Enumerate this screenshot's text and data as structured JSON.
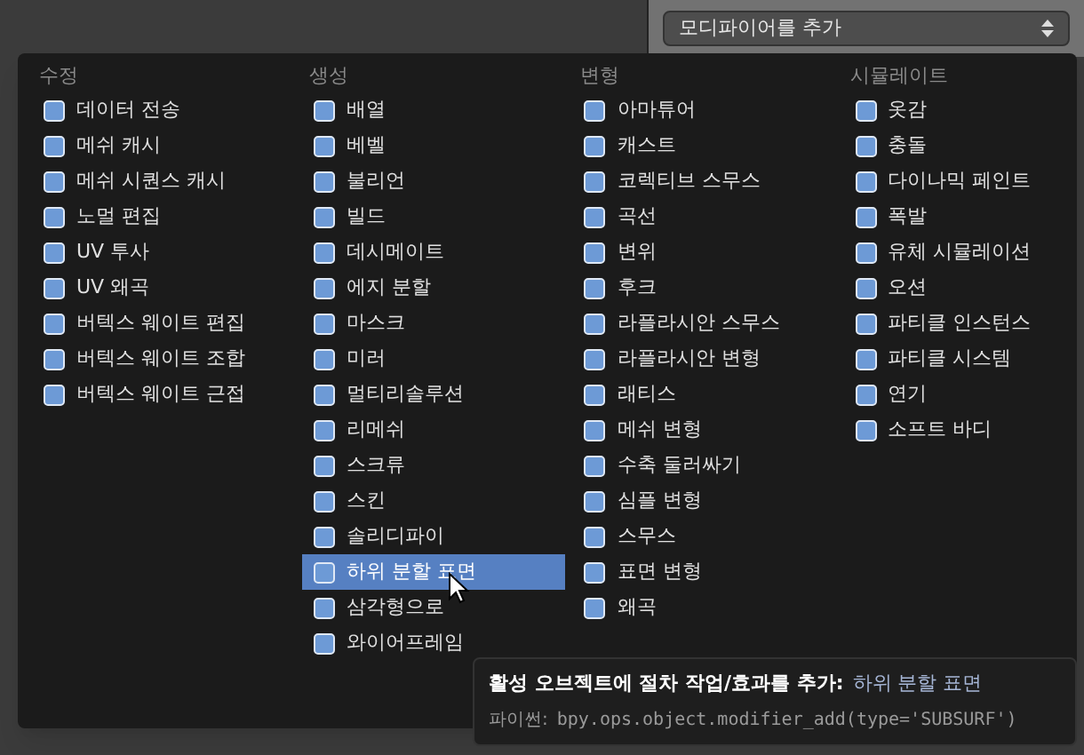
{
  "panel": {
    "dropdown": "모디파이어를 추가"
  },
  "menu": {
    "columns": [
      {
        "title": "수정",
        "items": [
          {
            "label": "데이터 전송",
            "selected": false
          },
          {
            "label": "메쉬 캐시",
            "selected": false
          },
          {
            "label": "메쉬 시퀀스 캐시",
            "selected": false
          },
          {
            "label": "노멀 편집",
            "selected": false
          },
          {
            "label": "UV 투사",
            "selected": false
          },
          {
            "label": "UV 왜곡",
            "selected": false
          },
          {
            "label": "버텍스 웨이트 편집",
            "selected": false
          },
          {
            "label": "버텍스 웨이트 조합",
            "selected": false
          },
          {
            "label": "버텍스 웨이트 근접",
            "selected": false
          }
        ]
      },
      {
        "title": "생성",
        "items": [
          {
            "label": "배열",
            "selected": false
          },
          {
            "label": "베벨",
            "selected": false
          },
          {
            "label": "불리언",
            "selected": false
          },
          {
            "label": "빌드",
            "selected": false
          },
          {
            "label": "데시메이트",
            "selected": false
          },
          {
            "label": "에지 분할",
            "selected": false
          },
          {
            "label": "마스크",
            "selected": false
          },
          {
            "label": "미러",
            "selected": false
          },
          {
            "label": "멀티리솔루션",
            "selected": false
          },
          {
            "label": "리메쉬",
            "selected": false
          },
          {
            "label": "스크류",
            "selected": false
          },
          {
            "label": "스킨",
            "selected": false
          },
          {
            "label": "솔리디파이",
            "selected": false
          },
          {
            "label": "하위 분할 표면",
            "selected": true
          },
          {
            "label": "삼각형으로",
            "selected": false
          },
          {
            "label": "와이어프레임",
            "selected": false
          }
        ]
      },
      {
        "title": "변형",
        "items": [
          {
            "label": "아마튜어",
            "selected": false
          },
          {
            "label": "캐스트",
            "selected": false
          },
          {
            "label": "코렉티브 스무스",
            "selected": false
          },
          {
            "label": "곡선",
            "selected": false
          },
          {
            "label": "변위",
            "selected": false
          },
          {
            "label": "후크",
            "selected": false
          },
          {
            "label": "라플라시안 스무스",
            "selected": false
          },
          {
            "label": "라플라시안 변형",
            "selected": false
          },
          {
            "label": "래티스",
            "selected": false
          },
          {
            "label": "메쉬 변형",
            "selected": false
          },
          {
            "label": "수축 둘러싸기",
            "selected": false
          },
          {
            "label": "심플 변형",
            "selected": false
          },
          {
            "label": "스무스",
            "selected": false
          },
          {
            "label": "표면 변형",
            "selected": false
          },
          {
            "label": "왜곡",
            "selected": false
          }
        ]
      },
      {
        "title": "시뮬레이트",
        "items": [
          {
            "label": "옷감",
            "selected": false
          },
          {
            "label": "충돌",
            "selected": false
          },
          {
            "label": "다이나믹 페인트",
            "selected": false
          },
          {
            "label": "폭발",
            "selected": false
          },
          {
            "label": "유체 시뮬레이션",
            "selected": false
          },
          {
            "label": "오션",
            "selected": false
          },
          {
            "label": "파티클 인스턴스",
            "selected": false
          },
          {
            "label": "파티클 시스템",
            "selected": false
          },
          {
            "label": "연기",
            "selected": false
          },
          {
            "label": "소프트 바디",
            "selected": false
          }
        ]
      }
    ]
  },
  "tooltip": {
    "text": "활성 오브젝트에 절차 작업/효과를 추가:",
    "value": "하위 분할 표면",
    "python_label": "파이썬:",
    "python": "bpy.ops.object.modifier_add(type='SUBSURF')"
  }
}
